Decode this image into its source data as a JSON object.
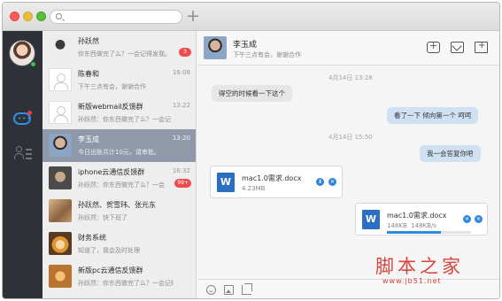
{
  "toolbar": {
    "add_symbol": "+"
  },
  "conversations": [
    {
      "name": "孙跃然",
      "preview": "你东西做完了么？一会记得发我。",
      "time": "",
      "unread": "3",
      "avatar_color": "#cfcfcf"
    },
    {
      "name": "陈春和",
      "preview": "下午三点有会，谢谢合作",
      "time": "16:08",
      "unread": "",
      "avatar_color": "#ffffff"
    },
    {
      "name": "新版webmail反馈群",
      "preview": "孙跃然：你东西做完了么？一会记",
      "time": "13:22",
      "unread": "",
      "avatar_color": "#ffffff"
    },
    {
      "name": "李玉成",
      "preview": "今日出账共计10元，请审批。",
      "time": "13:20",
      "unread": "",
      "avatar_color": "#7a8aa5"
    },
    {
      "name": "iphone云通信反馈群",
      "preview": "孙跃然：你东西做完了么？一会",
      "time": "16:32",
      "unread": "99+",
      "avatar_color": "#6b6b6b"
    },
    {
      "name": "孙跃然、贺雪玮、张元东",
      "preview": "孙跃然：快下班了",
      "time": "",
      "unread": "",
      "avatar_color": "#b88a5e"
    },
    {
      "name": "财务系统",
      "preview": "知道了，我会及时处理",
      "time": "",
      "unread": "",
      "avatar_color": "#d99a34"
    },
    {
      "name": "新版pc云通信反馈群",
      "preview": "孙跃然：你东西做完了么？一会记得发我。明…",
      "time": "",
      "unread": "",
      "avatar_color": "#c9843e"
    }
  ],
  "chat": {
    "title": "李玉成",
    "subtitle": "下午三点有会，谢谢合作",
    "messages": [
      {
        "kind": "time",
        "text": "4月14日 13:28"
      },
      {
        "kind": "in",
        "text": "得空的时候看一下这个"
      },
      {
        "kind": "out",
        "text": "看了一下 倾向第一个 呵呵"
      },
      {
        "kind": "time",
        "text": "4月14日 15:50"
      },
      {
        "kind": "out",
        "text": "我一会答复你吧"
      }
    ],
    "file_in": {
      "icon_letter": "W",
      "name": "mac1.0需求.docx",
      "size": "4.23MB",
      "download_symbol": "⬇",
      "cancel_symbol": "✕"
    },
    "file_out": {
      "icon_letter": "W",
      "name": "mac1.0需求.docx",
      "size": "148KB",
      "speed": "148KB/s",
      "progress": 0.64,
      "pause_symbol": "✕",
      "cancel_symbol": "✕"
    }
  },
  "watermark": {
    "brand": "脚本之家",
    "url": "www.jb51.net"
  }
}
